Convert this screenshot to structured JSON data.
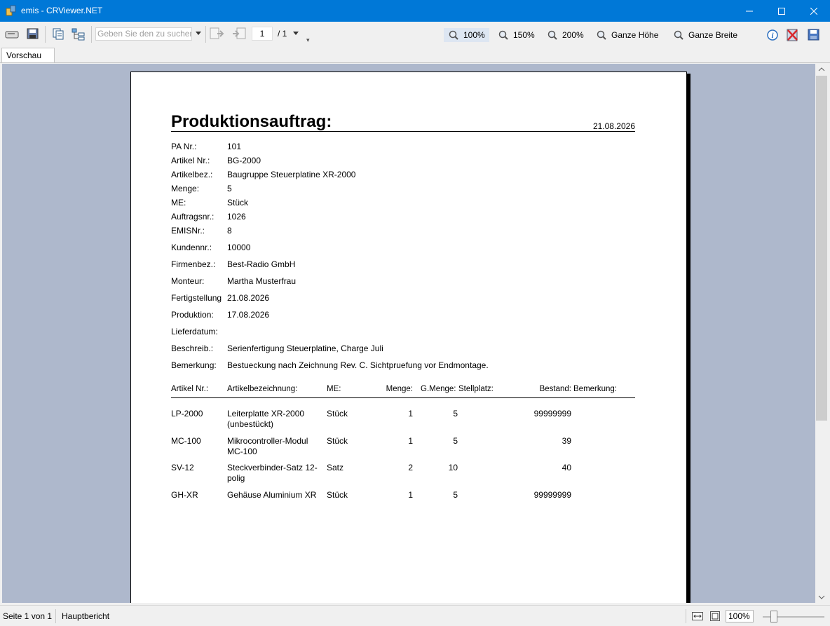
{
  "window": {
    "title": "emis - CRViewer.NET"
  },
  "toolbar": {
    "search_placeholder": "Geben Sie den zu suchen",
    "page_current": "1",
    "page_total": "/ 1",
    "zoom": [
      {
        "label": "100%"
      },
      {
        "label": "150%"
      },
      {
        "label": "200%"
      },
      {
        "label": "Ganze Höhe"
      },
      {
        "label": "Ganze Breite"
      }
    ]
  },
  "tab": {
    "label": "Vorschau"
  },
  "report": {
    "title": "Produktionsauftrag:",
    "date": "21.08.2026",
    "fields": [
      {
        "label": "PA Nr.:",
        "value": "101"
      },
      {
        "label": "Artikel Nr.:",
        "value": "BG-2000"
      },
      {
        "label": "Artikelbez.:",
        "value": "Baugruppe Steuerplatine XR-2000"
      },
      {
        "label": "Menge:",
        "value": "5"
      },
      {
        "label": "ME:",
        "value": "Stück"
      },
      {
        "label": "Auftragsnr.:",
        "value": "1026"
      },
      {
        "label": "EMISNr.:",
        "value": "8"
      },
      {
        "label": "Kundennr.:",
        "value": "10000"
      },
      {
        "label": "Firmenbez.:",
        "value": "Best-Radio GmbH"
      },
      {
        "label": "Monteur:",
        "value": "Martha Musterfrau"
      },
      {
        "label": "Fertigstellung",
        "value": "21.08.2026"
      },
      {
        "label": "Produktion:",
        "value": "17.08.2026"
      },
      {
        "label": "Lieferdatum:",
        "value": ""
      },
      {
        "label": "Beschreib.:",
        "value": "Serienfertigung Steuerplatine, Charge Juli"
      },
      {
        "label": "Bemerkung:",
        "value": "Bestueckung nach Zeichnung Rev. C. Sichtpruefung vor Endmontage."
      }
    ],
    "columns": [
      "Artikel Nr.:",
      "Artikelbezeichnung:",
      "ME:",
      "Menge:",
      "G.Menge:",
      "Stellplatz:",
      "Bestand:",
      "Bemerkung:"
    ],
    "rows": [
      {
        "artikel": "LP-2000",
        "bezeichnung": "Leiterplatte XR-2000 (unbestückt)",
        "me": "Stück",
        "menge": "1",
        "gmenge": "5",
        "stellplatz": "",
        "bestand": "99999999",
        "bemerkung": ""
      },
      {
        "artikel": "MC-100",
        "bezeichnung": "Mikrocontroller-Modul MC-100",
        "me": "Stück",
        "menge": "1",
        "gmenge": "5",
        "stellplatz": "",
        "bestand": "39",
        "bemerkung": ""
      },
      {
        "artikel": "SV-12",
        "bezeichnung": "Steckverbinder-Satz 12-polig",
        "me": "Satz",
        "menge": "2",
        "gmenge": "10",
        "stellplatz": "",
        "bestand": "40",
        "bemerkung": ""
      },
      {
        "artikel": "GH-XR",
        "bezeichnung": "Gehäuse Aluminium XR",
        "me": "Stück",
        "menge": "1",
        "gmenge": "5",
        "stellplatz": "",
        "bestand": "99999999",
        "bemerkung": ""
      }
    ]
  },
  "status": {
    "page_info": "Seite 1 von 1",
    "report_name": "Hauptbericht",
    "zoom_value": "100%"
  },
  "colors": {
    "titlebar": "#0078d7",
    "viewport_bg": "#aeb8cc"
  }
}
